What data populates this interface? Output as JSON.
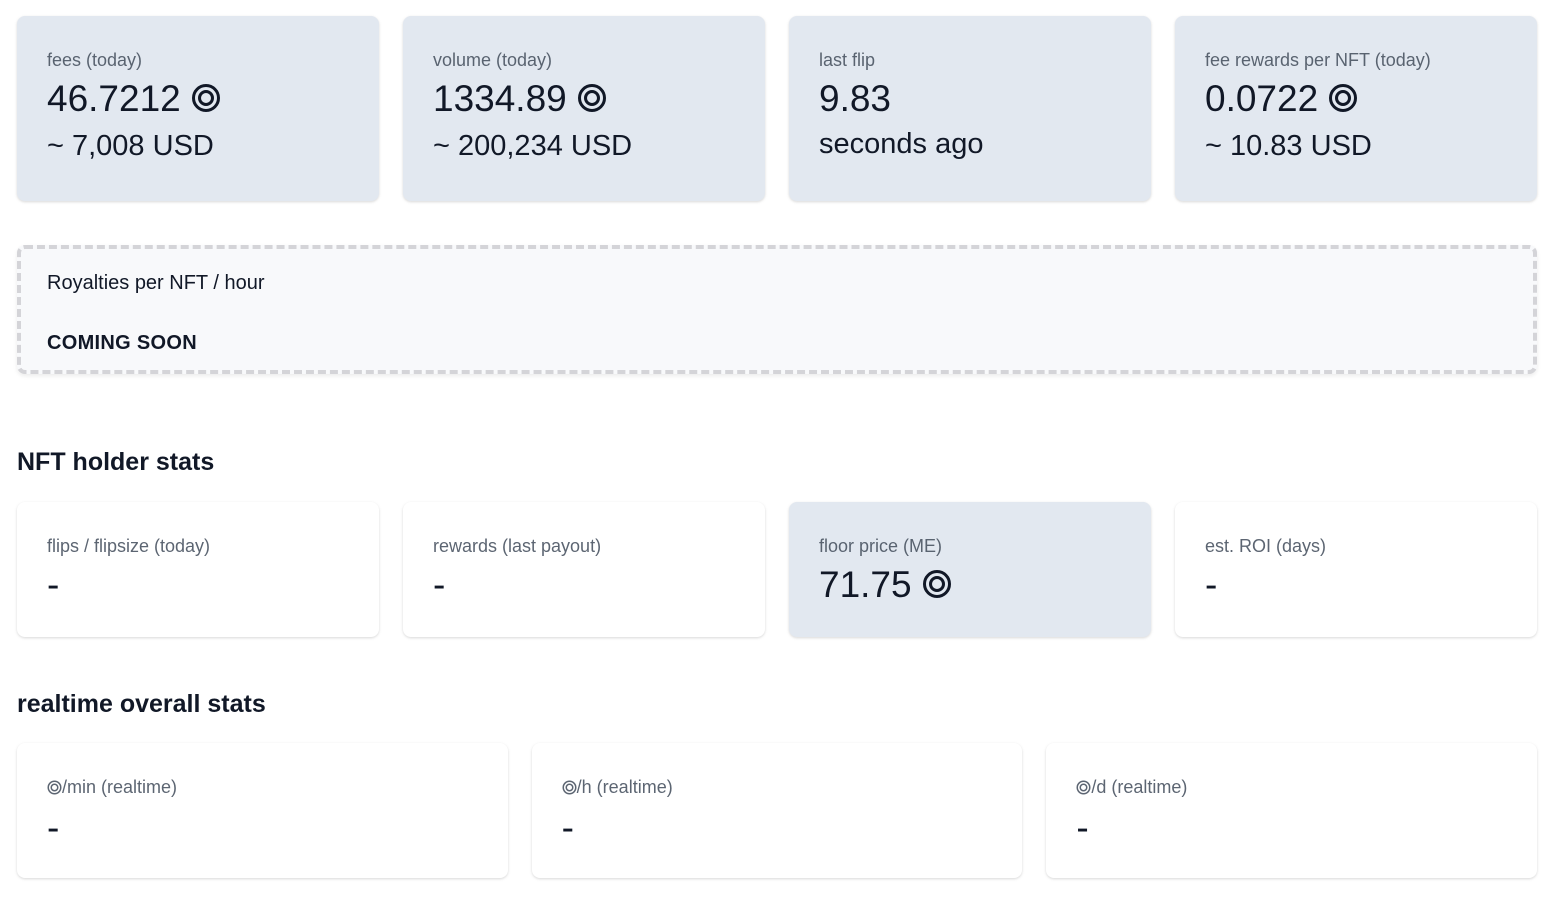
{
  "top_stats": [
    {
      "title": "fees (today)",
      "value": "46.7212",
      "currency_icon": "sol-coin-icon",
      "desc": "~ 7,008 USD"
    },
    {
      "title": "volume (today)",
      "value": "1334.89",
      "currency_icon": "sol-coin-icon",
      "desc": "~ 200,234 USD"
    },
    {
      "title": "last flip",
      "value": "9.83",
      "desc": "seconds ago"
    },
    {
      "title": "fee rewards per NFT (today)",
      "value": "0.0722",
      "currency_icon": "sol-coin-icon",
      "desc": "~ 10.83 USD"
    }
  ],
  "royalties_banner": {
    "title": "Royalties per NFT / hour",
    "status": "COMING SOON"
  },
  "holder_section": {
    "title": "NFT holder stats",
    "stats": [
      {
        "title": "flips / flipsize (today)",
        "value": "-"
      },
      {
        "title": "rewards (last payout)",
        "value": "-"
      },
      {
        "title": "floor price (ME)",
        "value": "71.75",
        "currency_icon": "sol-coin-icon"
      },
      {
        "title": "est. ROI (days)",
        "value": "-"
      }
    ]
  },
  "realtime_section": {
    "title": "realtime overall stats",
    "stats": [
      {
        "title": "/min (realtime)",
        "title_icon": "sol-coin-icon",
        "value": "-"
      },
      {
        "title": "/h (realtime)",
        "title_icon": "sol-coin-icon",
        "value": "-"
      },
      {
        "title": "/d (realtime)",
        "title_icon": "sol-coin-icon",
        "value": "-"
      }
    ]
  },
  "colors": {
    "card_filled": "#e2e8f0",
    "card_plain": "#ffffff",
    "text_primary": "#111827",
    "text_muted": "#4b5563",
    "dashed_border": "#d4d4d8"
  }
}
